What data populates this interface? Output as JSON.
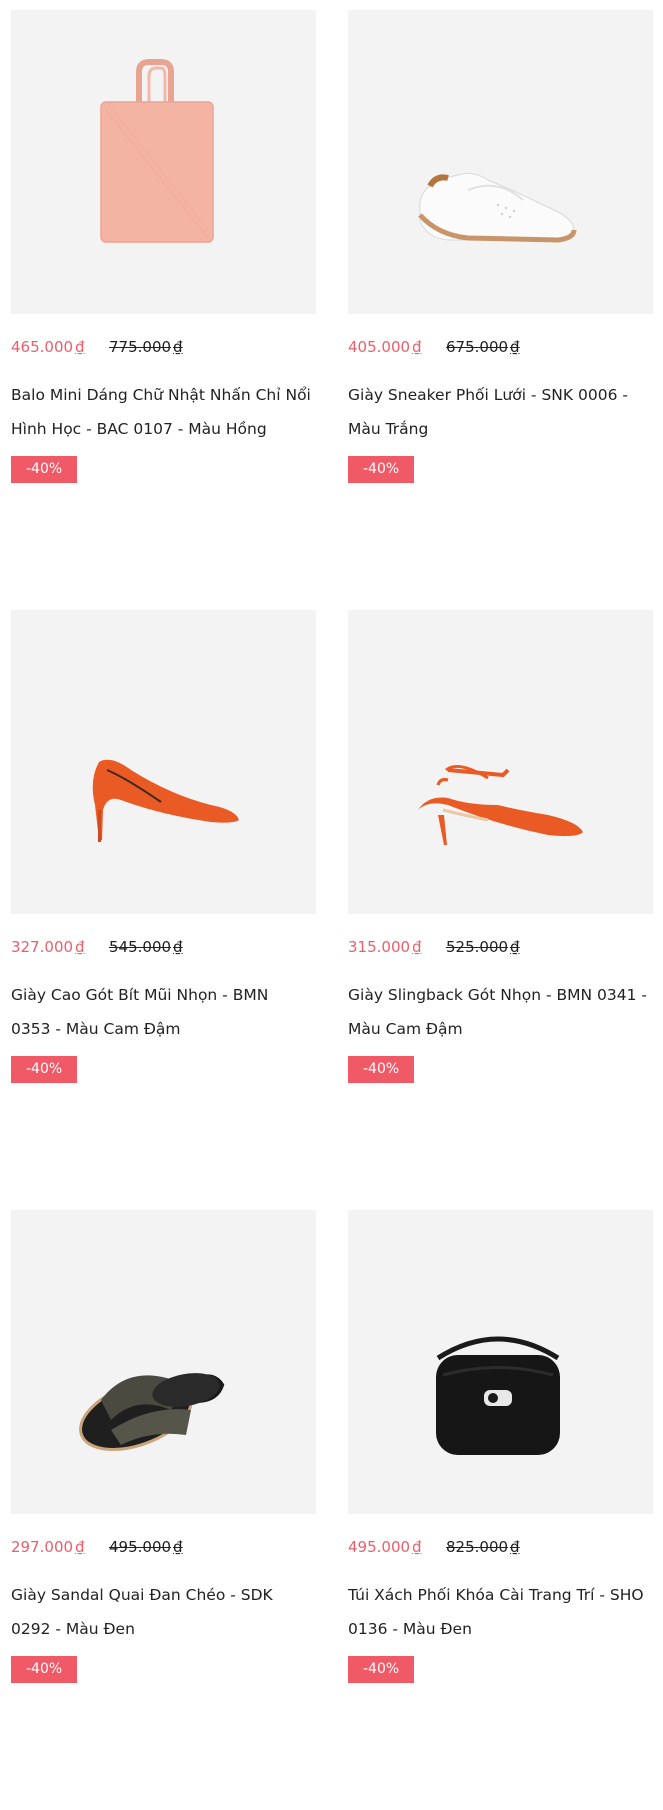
{
  "currency_symbol": "₫",
  "products": [
    {
      "image_icon": "pink-tote-bag-icon",
      "sale_price": "465.000",
      "original_price": "775.000",
      "name": "Balo Mini Dáng Chữ Nhật Nhấn Chỉ Nổi Hình Học - BAC 0107 - Màu Hồng",
      "discount": "-40%"
    },
    {
      "image_icon": "white-sneaker-icon",
      "sale_price": "405.000",
      "original_price": "675.000",
      "name": "Giày Sneaker Phối Lưới - SNK 0006 - Màu Trắng",
      "discount": "-40%"
    },
    {
      "image_icon": "orange-pump-heel-icon",
      "sale_price": "327.000",
      "original_price": "545.000",
      "name": "Giày Cao Gót Bít Mũi Nhọn - BMN 0353 - Màu Cam Đậm",
      "discount": "-40%"
    },
    {
      "image_icon": "orange-slingback-heel-icon",
      "sale_price": "315.000",
      "original_price": "525.000",
      "name": "Giày Slingback Gót Nhọn - BMN 0341 - Màu Cam Đậm",
      "discount": "-40%"
    },
    {
      "image_icon": "black-cross-strap-sandal-icon",
      "sale_price": "297.000",
      "original_price": "495.000",
      "name": "Giày Sandal Quai Đan Chéo - SDK 0292 - Màu Đen",
      "discount": "-40%"
    },
    {
      "image_icon": "black-handbag-icon",
      "sale_price": "495.000",
      "original_price": "825.000",
      "name": "Túi Xách Phối Khóa Cài Trang Trí - SHO 0136 - Màu Đen",
      "discount": "-40%"
    }
  ],
  "colors": {
    "sale_price": "#e8606b",
    "badge_bg": "#f05a67",
    "thumb_bg": "#f3f3f3"
  }
}
